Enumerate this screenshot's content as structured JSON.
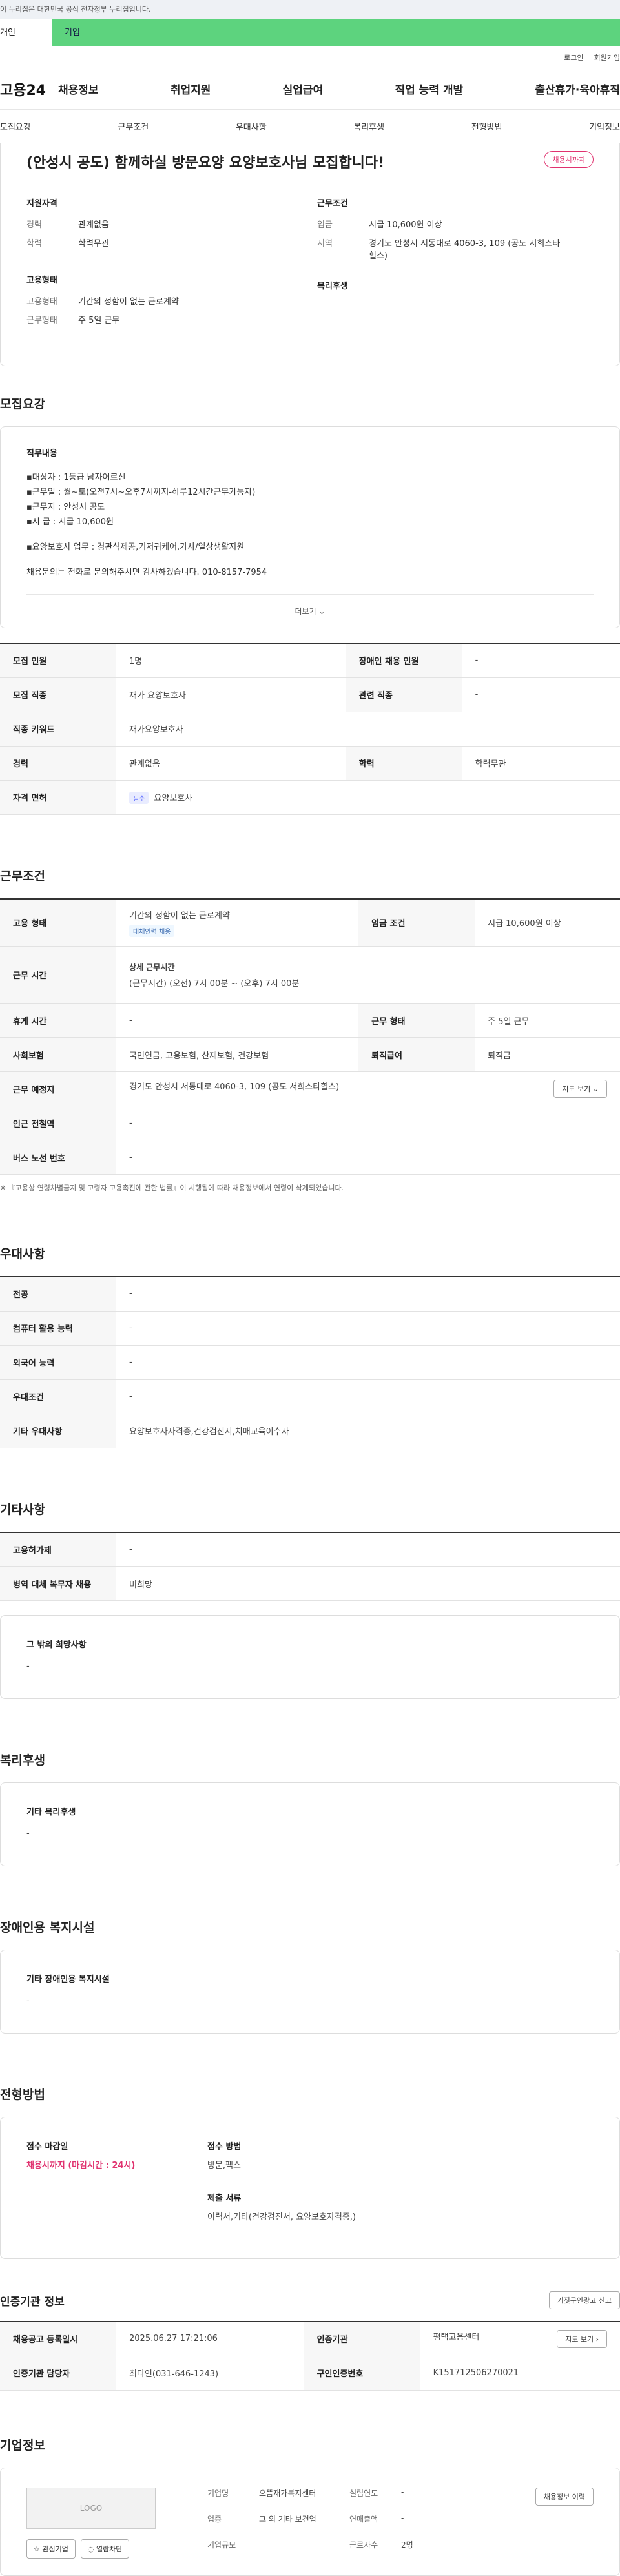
{
  "banner": {
    "text": "이 누리집은 대한민국 공식 전자정부 누리집입니다."
  },
  "top_tabs": [
    "개인",
    "기업"
  ],
  "util": {
    "login": "로그인",
    "join": "회원가입"
  },
  "gnb": {
    "logo": "고용24",
    "menu": [
      "채용정보",
      "취업지원",
      "실업급여",
      "직업 능력 개발",
      "출산휴가·육아휴직"
    ]
  },
  "anchor_nav": [
    "모집요강",
    "근무조건",
    "우대사항",
    "복리후생",
    "전형방법",
    "기업정보"
  ],
  "summary": {
    "title": "(안성시 공도) 함께하실 방문요양 요양보호사님 모집합니다!",
    "badge": "채용시까지",
    "qual_title": "지원자격",
    "career_k": "경력",
    "career_v": "관계없음",
    "edu_k": "학력",
    "edu_v": "학력무관",
    "emp_title": "고용형태",
    "emptype_k": "고용형태",
    "emptype_v": "기간의 정함이 없는 근로계약",
    "worktype_k": "근무형태",
    "worktype_v": "주 5일 근무",
    "cond_title": "근무조건",
    "wage_k": "임금",
    "wage_v": "시급 10,600원 이상",
    "region_k": "지역",
    "region_v": "경기도 안성시 서동대로 4060-3, 109 (공도 서희스타힐스)",
    "welfare_title": "복리후생"
  },
  "recruit": {
    "section": "모집요강",
    "duty_title": "직무내용",
    "lines": [
      "▪대상자 : 1등급 남자어르신",
      "▪근무일 : 월~토(오전7시~오후7시까지-하루12시간근무가능자)",
      "▪근무지 : 안성시 공도",
      "▪시    급 : 시급 10,600원"
    ],
    "line2": "▪요양보호사 업무 : 경관식제공,기저귀케어,가사/일상생활지원",
    "contact": "채용문의는 전화로 문의해주시면 감사하겠습니다. 010-8157-7954",
    "more": "더보기 ⌄",
    "rows": [
      {
        "k1": "모집 인원",
        "v1": "1명",
        "k2": "장애인 채용 인원",
        "v2": "-"
      },
      {
        "k1": "모집 직종",
        "v1": "재가 요양보호사",
        "k2": "관련 직종",
        "v2": "-"
      }
    ],
    "keyword_k": "직종 키워드",
    "keyword_v": "재가요양보호사",
    "career_k": "경력",
    "career_v": "관계없음",
    "edu_k": "학력",
    "edu_v": "학력무관",
    "license_k": "자격 면허",
    "license_tag": "필수",
    "license_v": "요양보호사"
  },
  "work": {
    "section": "근무조건",
    "emp_k": "고용 형태",
    "emp_v": "기간의 정함이 없는 근로계약",
    "emp_tag": "대체인력 채용",
    "wage_k": "임금 조건",
    "wage_v": "시급 10,600원 이상",
    "time_k": "근무 시간",
    "time_title": "상세 근무시간",
    "time_v": "(근무시간) (오전) 7시 00분 ~ (오후) 7시 00분",
    "rest_k": "휴게 시간",
    "rest_v": "-",
    "form_k": "근무 형태",
    "form_v": "주 5일 근무",
    "ins_k": "사회보험",
    "ins_v": "국민연금, 고용보험, 산재보험, 건강보험",
    "retire_k": "퇴직급여",
    "retire_v": "퇴직금",
    "place_k": "근무 예정지",
    "place_v": "경기도 안성시 서동대로 4060-3, 109 (공도 서희스타힐스)",
    "map_btn": "지도 보기 ⌄",
    "subway_k": "인근 전철역",
    "subway_v": "-",
    "bus_k": "버스 노선 번호",
    "bus_v": "-",
    "note": "※ 『고용상 연령차별금지 및 고령자 고용촉진에 관한 법률』이 시행됨에 따라 채용정보에서 연령이 삭제되었습니다."
  },
  "pref": {
    "section": "우대사항",
    "rows": [
      {
        "k": "전공",
        "v": "-"
      },
      {
        "k": "컴퓨터 활용 능력",
        "v": "-"
      },
      {
        "k": "외국어 능력",
        "v": "-"
      },
      {
        "k": "우대조건",
        "v": "-"
      },
      {
        "k": "기타 우대사항",
        "v": "요양보호사자격증,건강검진서,치매교육이수자"
      }
    ]
  },
  "etc": {
    "section": "기타사항",
    "rows": [
      {
        "k": "고용허가제",
        "v": "-"
      },
      {
        "k": "병역 대체 복무자 채용",
        "v": "비희망"
      }
    ],
    "hope_title": "그 밖의 희망사항",
    "hope_v": "-"
  },
  "welfare": {
    "section": "복리후생",
    "title": "기타 복리후생",
    "v": "-"
  },
  "disabled": {
    "section": "장애인용 복지시설",
    "title": "기타 장애인용 복지시설",
    "v": "-"
  },
  "apply": {
    "section": "전형방법",
    "deadline_t": "접수 마감일",
    "deadline_v": "채용시까지 (마감시간 : 24시)",
    "method_t": "접수 방법",
    "method_v": "방문,팩스",
    "doc_t": "제출 서류",
    "doc_v": "이력서,기타(건강검진서, 요양보호자격증,)"
  },
  "inst": {
    "title": "인증기관 정보",
    "report_btn": "거짓구인광고 신고",
    "reg_k": "채용공고 등록일시",
    "reg_v": "2025.06.27 17:21:06",
    "org_k": "인증기관",
    "org_v": "평택고용센터",
    "map_btn": "지도 보기 ›",
    "mgr_k": "인증기관 담당자",
    "mgr_v": "최다인(031-646-1243)",
    "num_k": "구인인증번호",
    "num_v": "K151712506270021"
  },
  "company": {
    "section": "기업정보",
    "logo": "LOGO",
    "fav": "☆ 관심기업",
    "block": "◌ 열람차단",
    "name_k": "기업명",
    "name_v": "으뜸재가복지센터",
    "year_k": "설립연도",
    "year_v": "-",
    "ind_k": "업종",
    "ind_v": "그 외 기타 보건업",
    "sales_k": "연매출액",
    "sales_v": "-",
    "scale_k": "기업규모",
    "scale_v": "-",
    "emp_k": "근로자수",
    "emp_v": "2명",
    "history_btn": "채용정보 이력"
  },
  "colors": {
    "accent": "#e0326f",
    "tab_green": "#5dd37e"
  }
}
